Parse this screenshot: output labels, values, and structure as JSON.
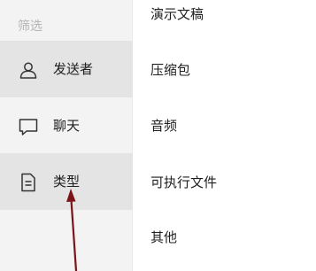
{
  "sidebar": {
    "heading": "筛选",
    "items": [
      {
        "label": "发送者",
        "icon": "person-icon",
        "active": true
      },
      {
        "label": "聊天",
        "icon": "chat-bubble-icon",
        "active": false
      },
      {
        "label": "类型",
        "icon": "document-icon",
        "active": true
      }
    ]
  },
  "type_list": {
    "options": [
      "演示文稿",
      "压缩包",
      "音频",
      "可执行文件",
      "其他"
    ]
  },
  "colors": {
    "sidebar_bg": "#f3f3f3",
    "active_item_bg": "#e4e4e4",
    "heading_text": "#b5b5b5",
    "body_text": "#1f1f1f",
    "annotation_arrow": "#7a1418"
  }
}
